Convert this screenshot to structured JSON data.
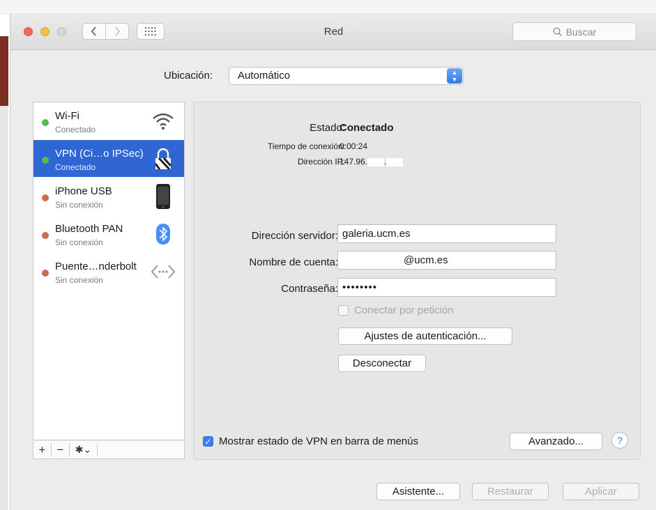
{
  "window": {
    "title": "Red"
  },
  "search": {
    "placeholder": "Buscar"
  },
  "location": {
    "label": "Ubicación:",
    "value": "Automático"
  },
  "services": [
    {
      "name": "Wi-Fi",
      "status": "Conectado",
      "icon": "wifi-icon",
      "status_color": "#56bd4c"
    },
    {
      "name": "VPN (Ci…o IPSec)",
      "status": "Conectado",
      "icon": "vpn-lock-icon",
      "status_color": "#56bd4c",
      "selected": true
    },
    {
      "name": "iPhone USB",
      "status": "Sin conexión",
      "icon": "iphone-icon",
      "status_color": "#d0684d"
    },
    {
      "name": "Bluetooth PAN",
      "status": "Sin conexión",
      "icon": "bluetooth-icon",
      "status_color": "#d0684d"
    },
    {
      "name": "Puente…nderbolt",
      "status": "Sin conexión",
      "icon": "thunderbolt-bridge-icon",
      "status_color": "#d0684d"
    }
  ],
  "sidebar_tools": {
    "add": "+",
    "remove": "−",
    "gear": "✱⌄"
  },
  "status": {
    "label": "Estado:",
    "value": "Conectado",
    "time_label": "Tiempo de conexión:",
    "time_value": "0:00:24",
    "ip_label": "Dirección IP:",
    "ip_value": "147.96.",
    "ip_separator": "."
  },
  "form": {
    "server_label": "Dirección servidor:",
    "server_value": "galeria.ucm.es",
    "account_label": "Nombre de cuenta:",
    "account_value": "@ucm.es",
    "password_label": "Contraseña:",
    "password_value": "••••••••",
    "on_demand_label": "Conectar por petición",
    "auth_button": "Ajustes de autenticación...",
    "disconnect_button": "Desconectar"
  },
  "footer": {
    "show_vpn_label": "Mostrar estado de VPN en barra de menús",
    "show_vpn_checked": true,
    "advanced_button": "Avanzado...",
    "help": "?"
  },
  "bottom_buttons": {
    "assistant": "Asistente...",
    "revert": "Restaurar",
    "apply": "Aplicar"
  },
  "colors": {
    "accent": "#3b7ef0",
    "selection": "#2f66d4"
  }
}
